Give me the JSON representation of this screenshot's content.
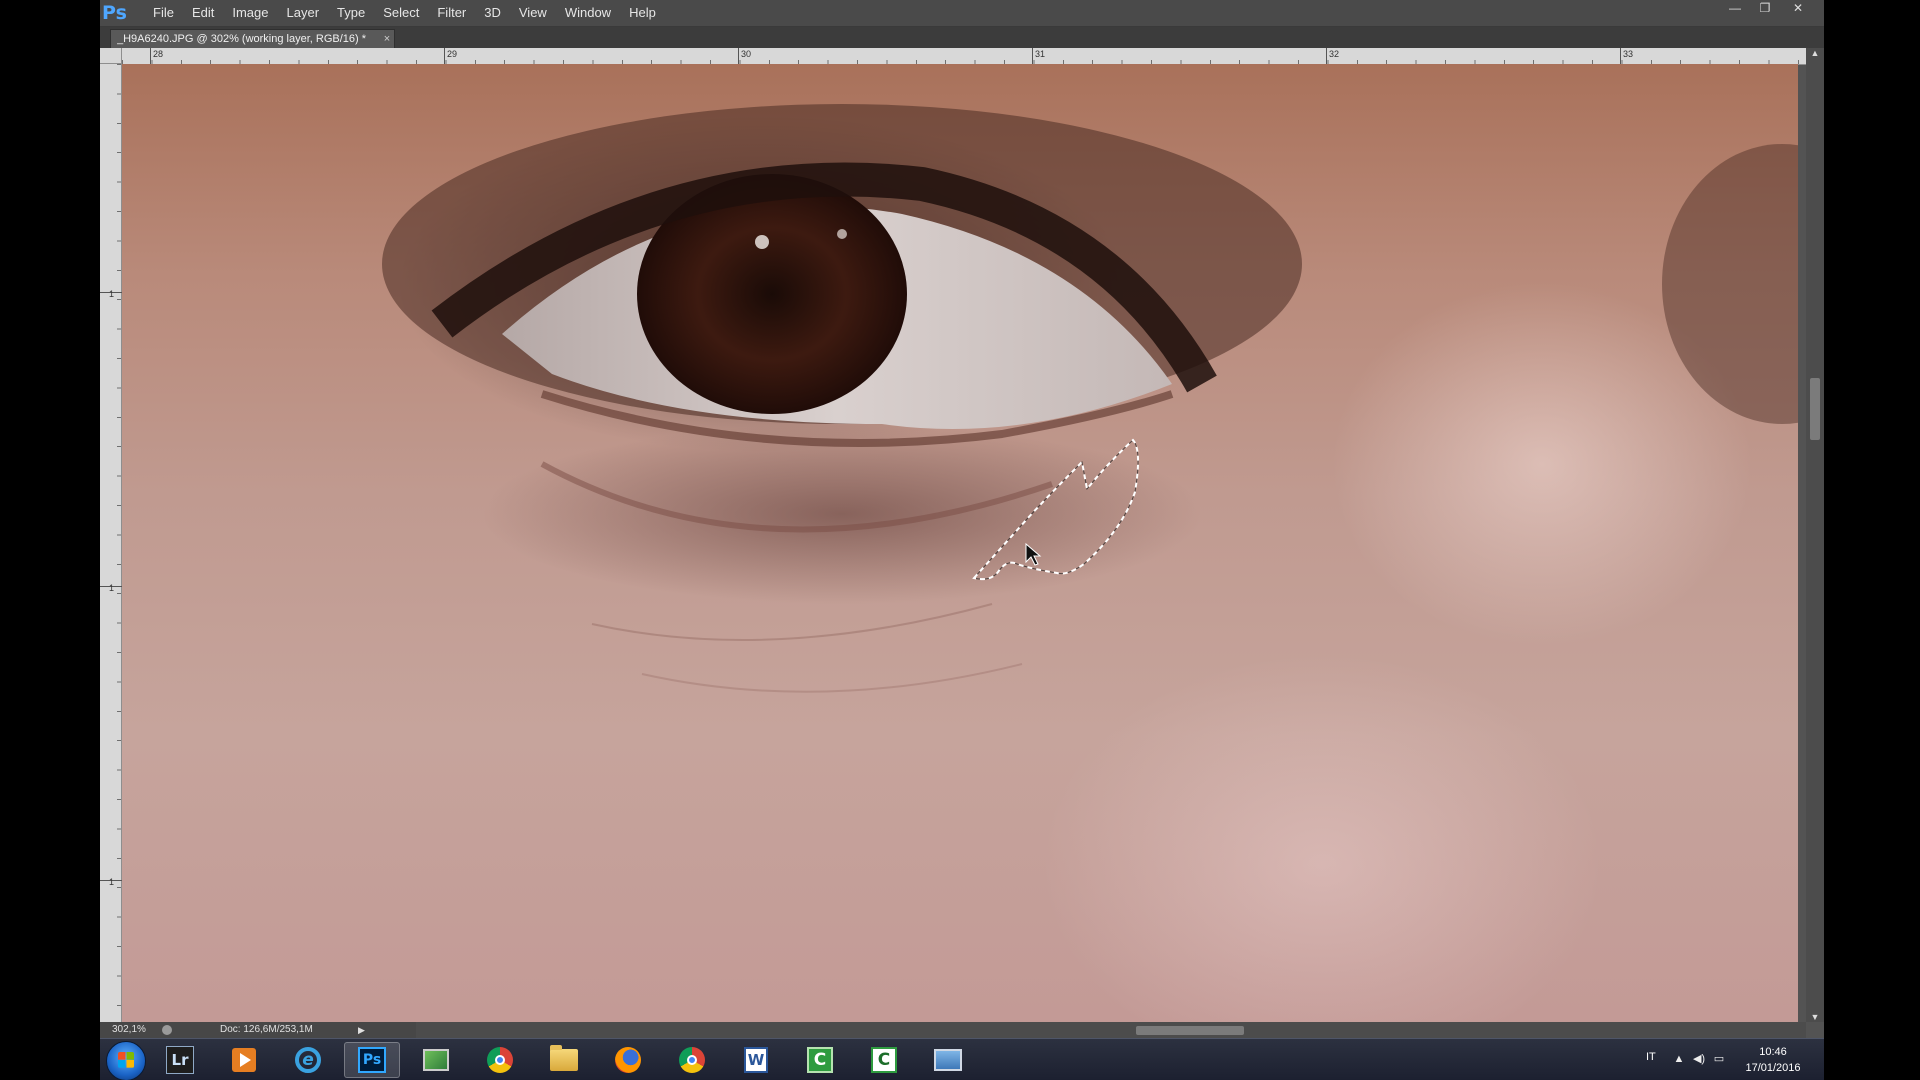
{
  "app": {
    "logo": "Ps",
    "menu": [
      "File",
      "Edit",
      "Image",
      "Layer",
      "Type",
      "Select",
      "Filter",
      "3D",
      "View",
      "Window",
      "Help"
    ],
    "window_controls": {
      "minimize": "—",
      "restore": "❐",
      "close": "✕"
    }
  },
  "document": {
    "tab_title": "_H9A6240.JPG @ 302% (working layer, RGB/16) *",
    "tab_close": "×"
  },
  "ruler": {
    "top_labels": [
      "28",
      "29",
      "30",
      "31",
      "32",
      "33"
    ],
    "left_labels": [
      "1",
      "1",
      "1"
    ]
  },
  "status": {
    "zoom": "302,1%",
    "doc_size": "Doc: 126,6M/253,1M",
    "arrow": "▶"
  },
  "taskbar": {
    "apps": [
      {
        "name": "lightroom",
        "label": "Lr"
      },
      {
        "name": "media-player",
        "label": ""
      },
      {
        "name": "internet-explorer",
        "label": "e"
      },
      {
        "name": "photoshop",
        "label": "Ps",
        "active": true
      },
      {
        "name": "system-monitor",
        "label": ""
      },
      {
        "name": "chrome",
        "label": ""
      },
      {
        "name": "file-explorer",
        "label": ""
      },
      {
        "name": "firefox",
        "label": ""
      },
      {
        "name": "chrome-2",
        "label": ""
      },
      {
        "name": "word",
        "label": "W"
      },
      {
        "name": "camtasia",
        "label": "C"
      },
      {
        "name": "camtasia-recorder",
        "label": "C"
      },
      {
        "name": "photo-gallery",
        "label": ""
      }
    ],
    "tray": {
      "language": "IT",
      "time": "10:46",
      "date": "17/01/2016"
    }
  },
  "colors": {
    "ps_blue": "#4fa7ff",
    "app_bg": "#535353",
    "taskbar": "#1c2030"
  }
}
